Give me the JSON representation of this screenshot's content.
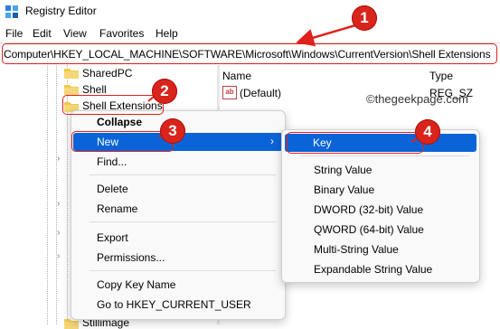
{
  "window": {
    "title": "Registry Editor"
  },
  "menu": [
    "File",
    "Edit",
    "View",
    "Favorites",
    "Help"
  ],
  "address": "Computer\\HKEY_LOCAL_MACHINE\\SOFTWARE\\Microsoft\\Windows\\CurrentVersion\\Shell Extensions",
  "tree": {
    "items": [
      "SharedPC",
      "Shell",
      "Shell Extensions"
    ],
    "partial": "Stillimage"
  },
  "values_pane": {
    "columns": [
      "Name",
      "Type"
    ],
    "rows": [
      {
        "name": "(Default)",
        "type": "REG_SZ",
        "icon": "string-value-icon"
      }
    ]
  },
  "watermark": "©thegeekpage.com",
  "context_menu": [
    "Collapse",
    "New",
    "Find...",
    "Delete",
    "Rename",
    "Export",
    "Permissions...",
    "Copy Key Name",
    "Go to HKEY_CURRENT_USER"
  ],
  "submenu": [
    "Key",
    "String Value",
    "Binary Value",
    "DWORD (32-bit) Value",
    "QWORD (64-bit) Value",
    "Multi-String Value",
    "Expandable String Value"
  ],
  "badges": [
    "1",
    "2",
    "3",
    "4"
  ],
  "colors": {
    "highlight": "#0a64d8",
    "annotation": "#e0201c",
    "folder": "#f2c94c"
  }
}
